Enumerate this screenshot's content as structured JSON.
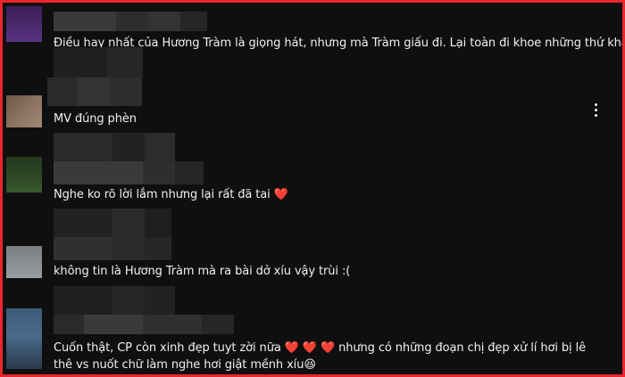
{
  "colors": {
    "frame_border": "#e8262c",
    "background": "#0f0f0f",
    "text": "#f1f1f1",
    "heart": "#e0242a"
  },
  "comments": [
    {
      "text": "Điều hay nhất của Hương Tràm là giọng hát, nhưng mà Tràm giấu đi. Lại toàn đi khoe những thứ khác 😄",
      "avatar_color": "#4a2a6e",
      "author_hidden": true
    },
    {
      "text": "MV đúng phèn",
      "avatar_color": "#8c7260",
      "author_hidden": true
    },
    {
      "text": "Nghe ko rõ lời lắm nhưng lại rất đã tai ❤️",
      "avatar_color": "#2e4a26",
      "author_hidden": true
    },
    {
      "text": "không tin là Hương Tràm mà ra bài dở xíu vậy trùi :(",
      "avatar_color": "#8a8e92",
      "author_hidden": true
    },
    {
      "text": "Cuốn thật, CP còn xinh đẹp tuyt zời nữa ❤️ ❤️ ❤️ nhưng có những đoạn chị đẹp xử lí hơi bị lê thê vs nuốt chữ làm nghe hơi giật mềnh xíu😆",
      "avatar_color": "#3e5a78",
      "author_hidden": true
    }
  ],
  "menu": {
    "icon": "more-vertical-icon"
  }
}
